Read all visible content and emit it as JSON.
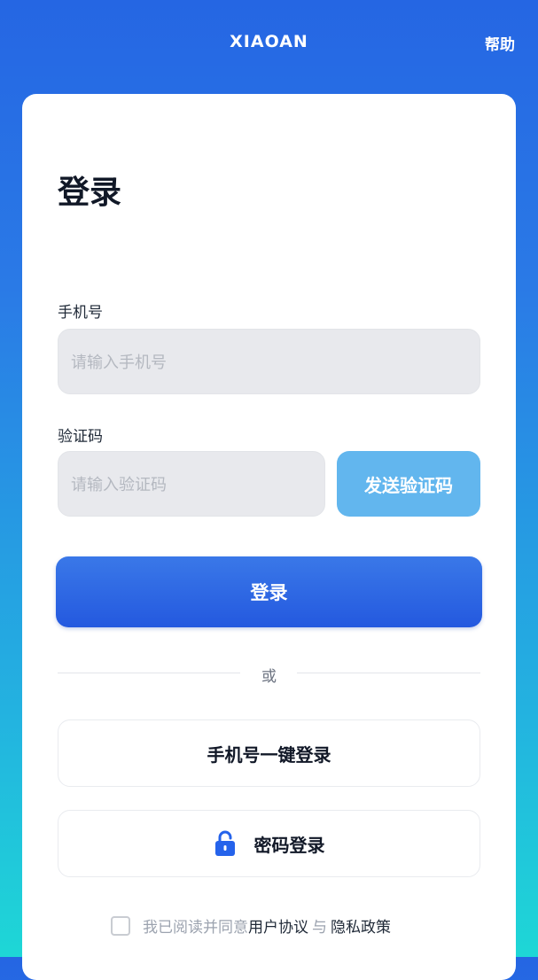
{
  "header": {
    "brand": "XIAOAN",
    "help": "帮助"
  },
  "form": {
    "title": "登录",
    "phone_label": "手机号",
    "phone_placeholder": "请输入手机号",
    "code_label": "验证码",
    "code_placeholder": "请输入验证码",
    "send_code": "发送验证码",
    "login": "登录",
    "or": "或",
    "one_click_login": "手机号一键登录",
    "password_login": "密码登录"
  },
  "agreement": {
    "prefix": "我已阅读并同意",
    "user_agreement": "用户协议",
    "and": "与",
    "privacy_policy": "隐私政策",
    "checked": false
  },
  "colors": {
    "primary": "#2459df",
    "send_button": "#62b6ee",
    "lock_icon": "#2563eb"
  }
}
